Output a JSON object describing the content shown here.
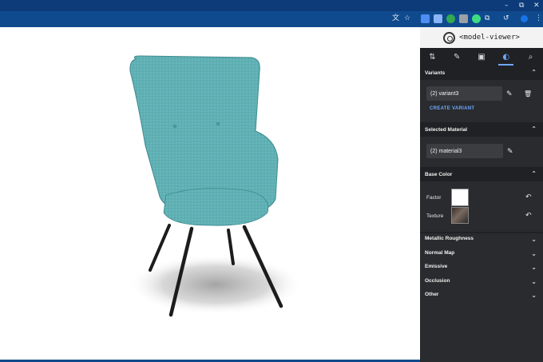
{
  "browser": {
    "window_controls": [
      "–",
      "⧉",
      "✕"
    ],
    "toolbar_icons": [
      "translate-icon",
      "star-icon",
      "extension-icon-1",
      "extension-icon-2",
      "extension-icon-3",
      "extension-icon-4",
      "extension-icon-5",
      "puzzle-icon",
      "history-icon",
      "profile-icon",
      "menu-icon"
    ]
  },
  "panel": {
    "title": "<model-viewer>",
    "tabs": [
      {
        "name": "tab-sort",
        "glyph": "⇅"
      },
      {
        "name": "tab-edit",
        "glyph": "✎"
      },
      {
        "name": "tab-camera",
        "glyph": "▣"
      },
      {
        "name": "tab-materials",
        "glyph": "◐"
      },
      {
        "name": "tab-search",
        "glyph": "⌕"
      }
    ],
    "variants": {
      "header": "Variants",
      "selected": "(2) variant3",
      "create_label": "CREATE VARIANT"
    },
    "selected_material": {
      "header": "Selected Material",
      "value": "(2) material3"
    },
    "base_color": {
      "header": "Base Color",
      "factor_label": "Factor",
      "texture_label": "Texture",
      "factor_color": "#ffffff"
    },
    "collapsed_sections": [
      "Metallic Roughness",
      "Normal Map",
      "Emissive",
      "Occlusion",
      "Other"
    ],
    "glyphs": {
      "expand": "⌃",
      "collapse": "⌄",
      "edit": "✎",
      "delete": "🗑",
      "reset": "↶"
    }
  },
  "model": {
    "fabric_color": "#5fb0b4",
    "leg_color": "#1c1c1c"
  }
}
